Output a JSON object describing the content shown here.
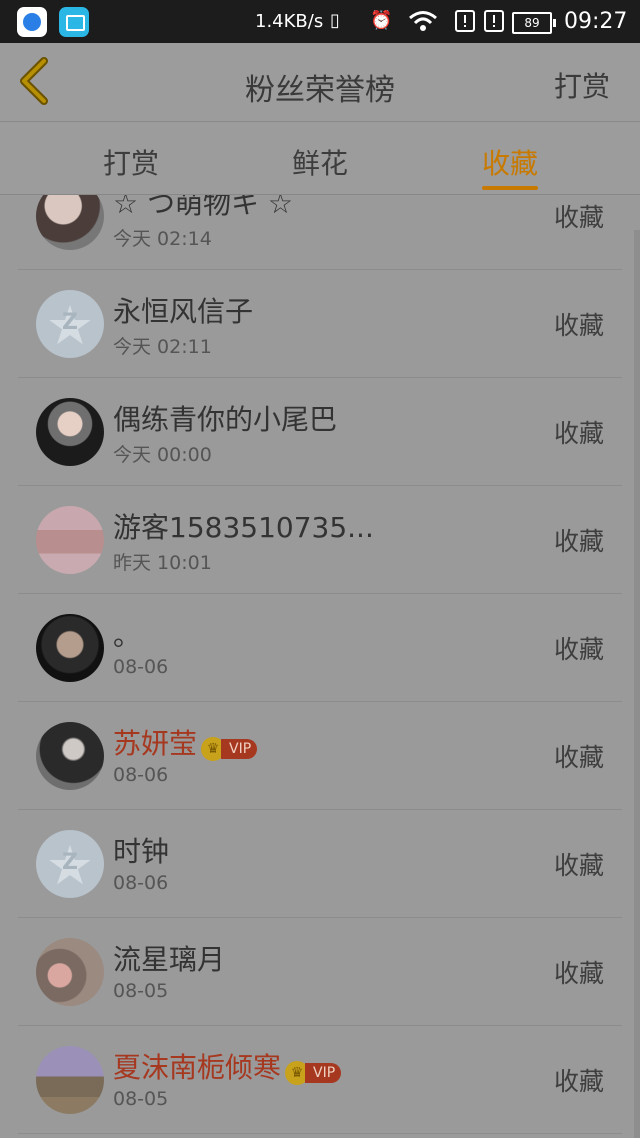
{
  "status_bar": {
    "speed": "1.4KB/s",
    "battery": "89",
    "time": "09:27"
  },
  "header": {
    "title": "粉丝荣誉榜",
    "action": "打赏"
  },
  "tabs": [
    {
      "label": "打赏"
    },
    {
      "label": "鲜花"
    },
    {
      "label": "收藏",
      "active": true
    }
  ],
  "rows": [
    {
      "name": "☆ つ萌物キ ☆",
      "time": "今天 02:14",
      "action": "收藏",
      "vip": false
    },
    {
      "name": "永恒风信子",
      "time": "今天 02:11",
      "action": "收藏",
      "vip": false
    },
    {
      "name": "偶练青你的小尾巴",
      "time": "今天 00:00",
      "action": "收藏",
      "vip": false
    },
    {
      "name": "游客1583510735...",
      "time": "昨天 10:01",
      "action": "收藏",
      "vip": false
    },
    {
      "name": "。",
      "time": "08-06",
      "action": "收藏",
      "vip": false
    },
    {
      "name": "苏妍莹",
      "time": "08-06",
      "action": "收藏",
      "vip": true
    },
    {
      "name": "时钟",
      "time": "08-06",
      "action": "收藏",
      "vip": false
    },
    {
      "name": "流星璃月",
      "time": "08-05",
      "action": "收藏",
      "vip": false
    },
    {
      "name": "夏沫南栀倾寒",
      "time": "08-05",
      "action": "收藏",
      "vip": true
    }
  ],
  "vip_label": "VIP",
  "colors": {
    "accent": "#c87a00",
    "vip_name": "#a63820"
  }
}
